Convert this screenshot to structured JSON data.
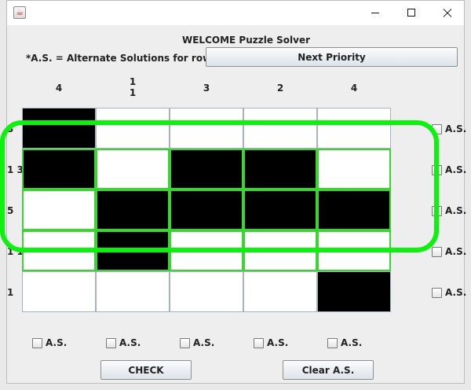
{
  "window": {
    "title": "",
    "app_icon": "java-app-icon"
  },
  "header": {
    "welcome": "WELCOME Puzzle Solver",
    "note": "*A.S. = Alternate Solutions for row/col",
    "next_priority_button": "Next Priority"
  },
  "column_clues": [
    {
      "lines": [
        "4"
      ]
    },
    {
      "lines": [
        "1",
        "1"
      ]
    },
    {
      "lines": [
        "3"
      ]
    },
    {
      "lines": [
        "2"
      ]
    },
    {
      "lines": [
        "4"
      ]
    }
  ],
  "row_clues": [
    "3",
    "1 3",
    "5",
    "1 1",
    "1"
  ],
  "grid": [
    [
      1,
      0,
      0,
      0,
      0
    ],
    [
      1,
      0,
      1,
      1,
      0
    ],
    [
      0,
      1,
      1,
      1,
      1
    ],
    [
      0,
      1,
      0,
      0,
      0
    ],
    [
      0,
      0,
      0,
      0,
      1
    ]
  ],
  "highlight": {
    "rows": [
      1,
      2,
      3
    ],
    "color": "#0ef00e"
  },
  "row_alt_checkbox_label": "A.S.",
  "col_alt_checkbox_label": "A.S.",
  "buttons": {
    "check": "CHECK",
    "clear_as": "Clear A.S."
  }
}
